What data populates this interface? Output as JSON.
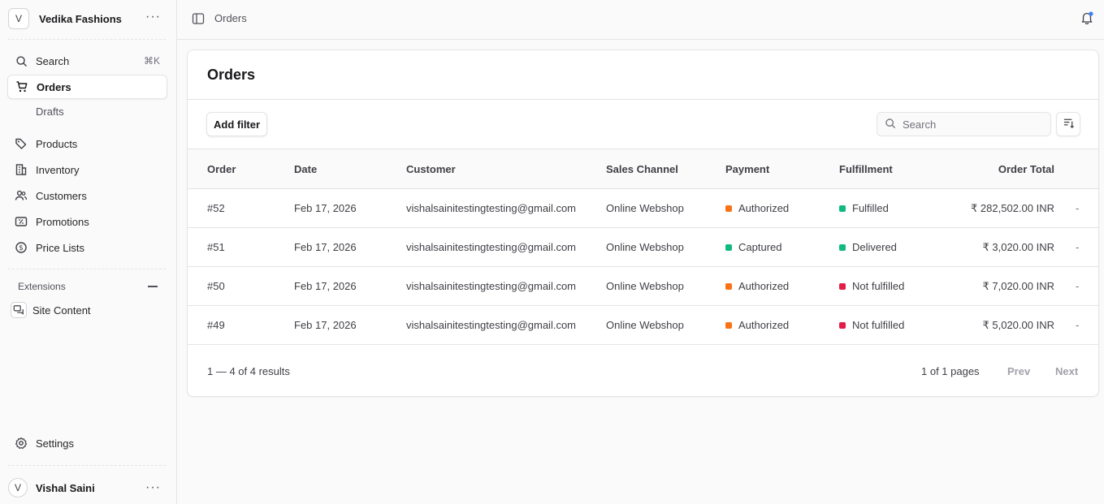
{
  "sidebar": {
    "store_initial": "V",
    "store_name": "Vedika Fashions",
    "search_label": "Search",
    "search_shortcut": "⌘K",
    "items": [
      {
        "label": "Orders"
      },
      {
        "label": "Drafts"
      },
      {
        "label": "Products"
      },
      {
        "label": "Inventory"
      },
      {
        "label": "Customers"
      },
      {
        "label": "Promotions"
      },
      {
        "label": "Price Lists"
      }
    ],
    "extensions_label": "Extensions",
    "site_content_label": "Site Content",
    "settings_label": "Settings",
    "user_initial": "V",
    "user_name": "Vishal Saini"
  },
  "topbar": {
    "breadcrumb": "Orders"
  },
  "main": {
    "title": "Orders",
    "add_filter_label": "Add filter",
    "search_placeholder": "Search",
    "columns": [
      "Order",
      "Date",
      "Customer",
      "Sales Channel",
      "Payment",
      "Fulfillment",
      "Order Total"
    ],
    "rows": [
      {
        "order": "#52",
        "date": "Feb 17, 2026",
        "customer": "vishalsainitestingtesting@gmail.com",
        "channel": "Online Webshop",
        "payment": "Authorized",
        "payment_color": "#f97316",
        "fulfillment": "Fulfilled",
        "fulfillment_color": "#10b981",
        "total": "₹ 282,502.00 INR",
        "action": "-"
      },
      {
        "order": "#51",
        "date": "Feb 17, 2026",
        "customer": "vishalsainitestingtesting@gmail.com",
        "channel": "Online Webshop",
        "payment": "Captured",
        "payment_color": "#10b981",
        "fulfillment": "Delivered",
        "fulfillment_color": "#10b981",
        "total": "₹ 3,020.00 INR",
        "action": "-"
      },
      {
        "order": "#50",
        "date": "Feb 17, 2026",
        "customer": "vishalsainitestingtesting@gmail.com",
        "channel": "Online Webshop",
        "payment": "Authorized",
        "payment_color": "#f97316",
        "fulfillment": "Not fulfilled",
        "fulfillment_color": "#e11d48",
        "total": "₹ 7,020.00 INR",
        "action": "-"
      },
      {
        "order": "#49",
        "date": "Feb 17, 2026",
        "customer": "vishalsainitestingtesting@gmail.com",
        "channel": "Online Webshop",
        "payment": "Authorized",
        "payment_color": "#f97316",
        "fulfillment": "Not fulfilled",
        "fulfillment_color": "#e11d48",
        "total": "₹ 5,020.00 INR",
        "action": "-"
      }
    ],
    "results_text": "1 — 4 of 4 results",
    "pages_text": "1 of 1 pages",
    "prev_label": "Prev",
    "next_label": "Next"
  }
}
